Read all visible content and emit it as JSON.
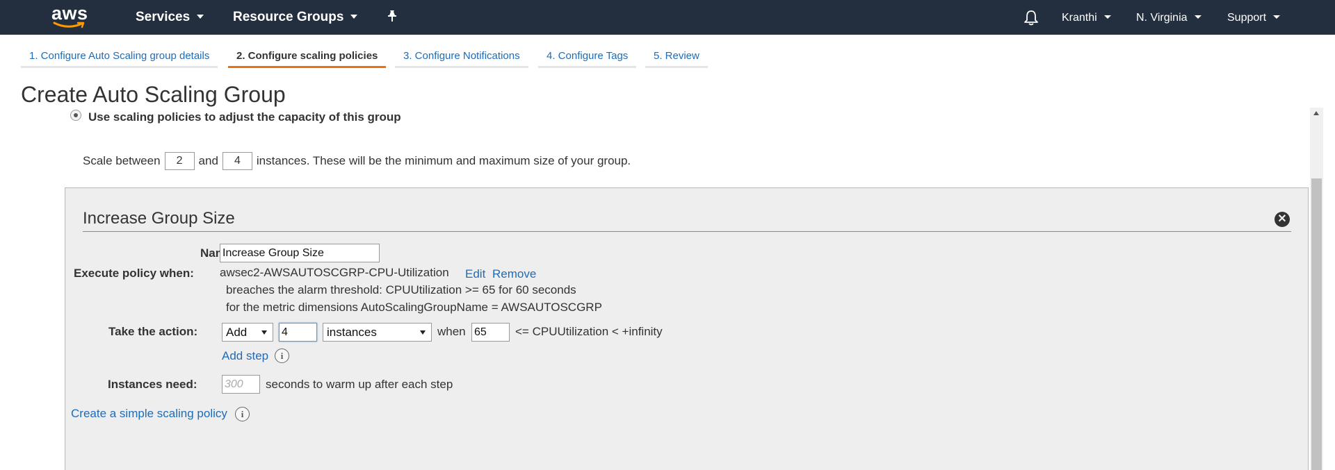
{
  "topnav": {
    "logo": "aws",
    "services_label": "Services",
    "resource_groups_label": "Resource Groups",
    "pin_icon": "pin-icon",
    "bell_icon": "bell-icon",
    "user_label": "Kranthi",
    "region_label": "N. Virginia",
    "support_label": "Support"
  },
  "wizard": {
    "steps": [
      {
        "label": "1. Configure Auto Scaling group details"
      },
      {
        "label": "2. Configure scaling policies",
        "active": true
      },
      {
        "label": "3. Configure Notifications"
      },
      {
        "label": "4. Configure Tags"
      },
      {
        "label": "5. Review"
      }
    ]
  },
  "page": {
    "title": "Create Auto Scaling Group"
  },
  "scaling": {
    "radio_label": "Use scaling policies to adjust the capacity of this group",
    "scale_prefix": "Scale between",
    "min_value": "2",
    "and_text": "and",
    "max_value": "4",
    "scale_suffix": "instances. These will be the minimum and maximum size of your group."
  },
  "policy": {
    "title": "Increase Group Size",
    "name_label": "Name:",
    "name_value": "Increase Group Size",
    "execute_label": "Execute policy when:",
    "alarm_name": "awsec2-AWSAUTOSCGRP-CPU-Utilization",
    "edit_label": "Edit",
    "remove_label": "Remove",
    "breach_text": "breaches the alarm threshold: CPUUtilization >= 65 for 60 seconds",
    "dimension_text": "for the metric dimensions AutoScalingGroupName = AWSAUTOSCGRP",
    "action_label": "Take the action:",
    "action_select": "Add",
    "action_amount": "4",
    "unit_select": "instances",
    "when_text": "when",
    "threshold_value": "65",
    "condition_text": "<= CPUUtilization < +infinity",
    "add_step_label": "Add step",
    "info_glyph": "i",
    "instances_label": "Instances need:",
    "warmup_placeholder": "300",
    "warmup_text": "seconds to warm up after each step",
    "simple_policy_link": "Create a simple scaling policy"
  },
  "colors": {
    "nav_bg": "#232f3e",
    "link": "#1e6bb8",
    "active_tab": "#ec7211",
    "panel_bg": "#eeeeee"
  }
}
